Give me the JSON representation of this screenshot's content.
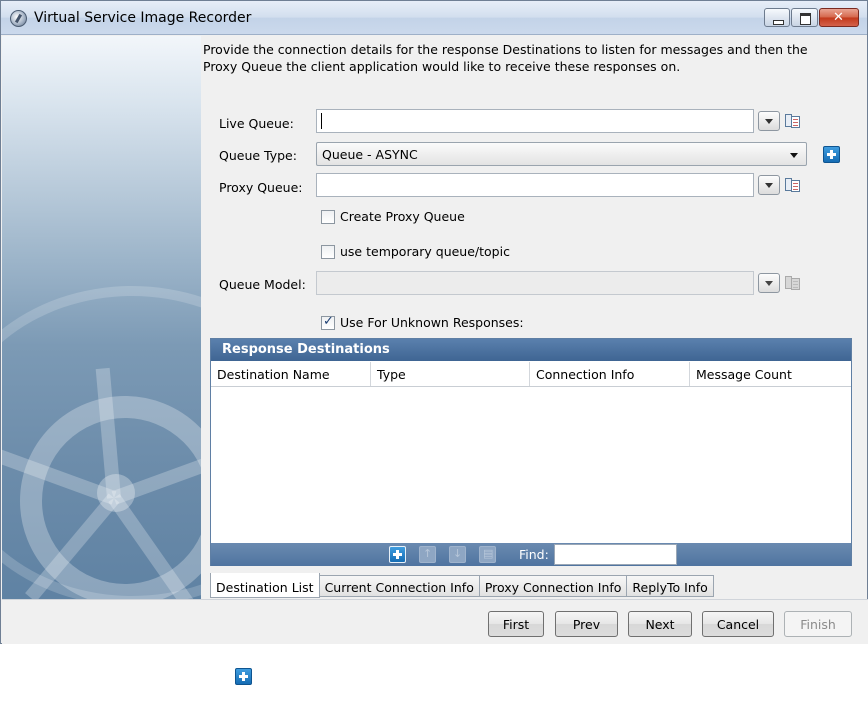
{
  "window": {
    "title": "Virtual Service Image Recorder",
    "icons": [
      "app-icon",
      "minimize-icon",
      "maximize-icon",
      "close-icon"
    ]
  },
  "intro_text": "Provide the connection details for the response Destinations to listen for messages and then the Proxy Queue the client application would like to receive these responses on.",
  "form": {
    "live_queue_label": "Live Queue:",
    "live_queue_value": "",
    "queue_type_label": "Queue Type:",
    "queue_type_value": "Queue - ASYNC",
    "proxy_queue_label": "Proxy Queue:",
    "proxy_queue_value": "",
    "create_proxy_queue_label": "Create Proxy Queue",
    "create_proxy_queue_checked": false,
    "use_temp_label": "use temporary queue/topic",
    "use_temp_checked": false,
    "queue_model_label": "Queue Model:",
    "queue_model_value": "",
    "unknown_responses_label": "Use For Unknown Responses:",
    "unknown_responses_checked": true
  },
  "response_destinations": {
    "title": "Response Destinations",
    "columns": [
      "Destination Name",
      "Type",
      "Connection Info",
      "Message Count"
    ],
    "rows": [],
    "find_label": "Find:",
    "find_value": "",
    "toolbar_icons": [
      "add-icon",
      "move-up-icon",
      "move-down-icon",
      "delete-icon"
    ]
  },
  "tabs": [
    "Destination List",
    "Current Connection Info",
    "Proxy Connection Info",
    "ReplyTo Info"
  ],
  "active_tab": "Destination List",
  "buttons": {
    "first": "First",
    "prev": "Prev",
    "next": "Next",
    "cancel": "Cancel",
    "finish": "Finish"
  },
  "colors": {
    "panel_header": "#4a71a0",
    "accent_blue": "#1a73c0",
    "close_button": "#c8442a"
  }
}
